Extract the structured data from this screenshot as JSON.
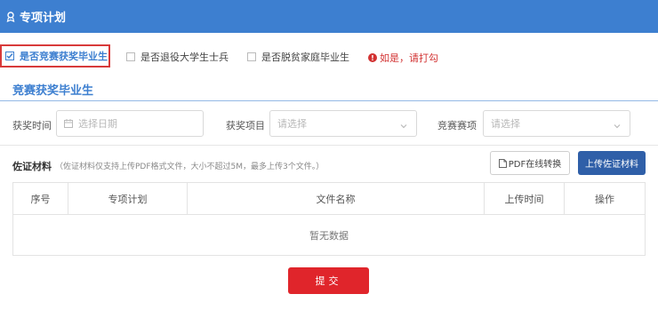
{
  "header": {
    "title": "专项计划",
    "icon": "user-badge-icon"
  },
  "checkboxes": [
    {
      "label": "是否竞赛获奖毕业生",
      "checked": true
    },
    {
      "label": "是否退役大学生士兵",
      "checked": false
    },
    {
      "label": "是否脱贫家庭毕业生",
      "checked": false
    }
  ],
  "hint": {
    "text": "如是，请打勾",
    "icon": "exclamation-icon"
  },
  "section": {
    "title": "竞赛获奖毕业生"
  },
  "form": {
    "award_time": {
      "label": "获奖时间",
      "placeholder": "选择日期"
    },
    "award_item": {
      "label": "获奖项目",
      "placeholder": "请选择"
    },
    "competition": {
      "label": "竞赛赛项",
      "placeholder": "请选择"
    }
  },
  "attachments": {
    "title": "佐证材料",
    "note": "（佐证材料仅支持上传PDF格式文件，大小不超过5M，最多上传3个文件。）",
    "pdf_button": "PDF在线转换",
    "upload_button": "上传佐证材料"
  },
  "table": {
    "columns": [
      "序号",
      "专项计划",
      "文件名称",
      "上传时间",
      "操作"
    ],
    "empty_text": "暂无数据"
  },
  "submit": {
    "label": "提交"
  },
  "colors": {
    "primary": "#3d7fd0",
    "danger": "#e0252b",
    "upload": "#2f5fa8"
  }
}
